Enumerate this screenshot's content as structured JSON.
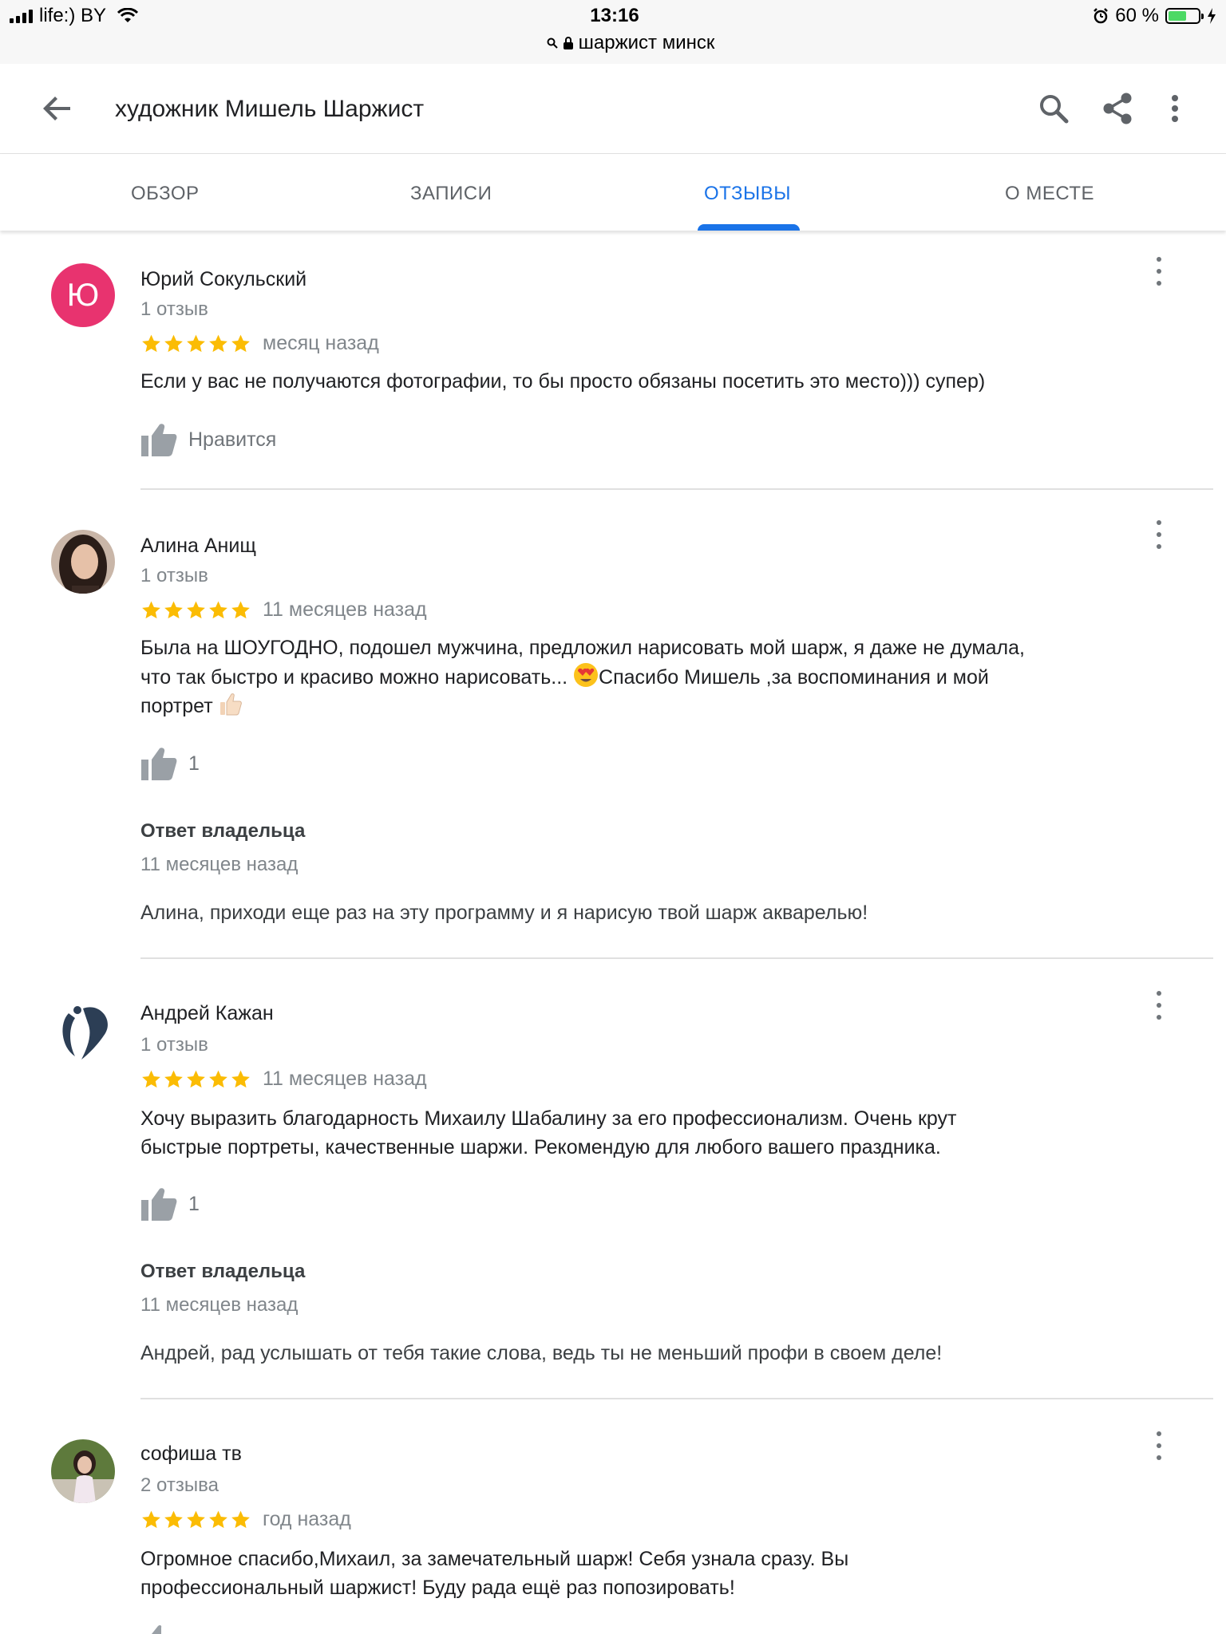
{
  "status_bar": {
    "carrier": "life:) BY",
    "time": "13:16",
    "url": "шаржист минск",
    "battery": "60 %",
    "battery_level": 0.6
  },
  "app_bar": {
    "title": "художник Мишель Шаржист",
    "icons": [
      "back-arrow-icon",
      "search-icon",
      "share-icon",
      "more-vert-icon"
    ]
  },
  "tabs": [
    {
      "label": "ОБЗОР",
      "active": false
    },
    {
      "label": "ЗАПИСИ",
      "active": false
    },
    {
      "label": "ОТЗЫВЫ",
      "active": true
    },
    {
      "label": "О МЕСТЕ",
      "active": false
    }
  ],
  "colors": {
    "accent": "#1a73e8",
    "star": "#fbbc04",
    "avatar_letter_bg": "#e8336f"
  },
  "reviews": [
    {
      "name": "Юрий Сокульский",
      "avatar_letter": "Ю",
      "count": "1 отзыв",
      "rating": 5,
      "date": "месяц назад",
      "text": "Если у вас не получаются фотографии, то бы просто обязаны посетить это место))) супер)",
      "like_label": "Нравится"
    },
    {
      "name": "Алина Анищ",
      "count": "1 отзыв",
      "rating": 5,
      "date": "11 месяцев назад",
      "text_lines": [
        "Была на ШОУГОДНО, подошел мужчина, предложил нарисовать мой шарж, я даже не думала,",
        "что так быстро и красиво можно нарисовать... ",
        "Спасибо Мишель ,за воспоминания и мой",
        "портрет "
      ],
      "likes": "1",
      "owner_reply": {
        "title": "Ответ владельца",
        "date": "11 месяцев назад",
        "text": "Алина, приходи еще раз на эту программу и я нарисую твой шарж акварелью!"
      }
    },
    {
      "name": "Андрей Кажан",
      "count": "1 отзыв",
      "rating": 5,
      "date": "11 месяцев назад",
      "text_lines": [
        "Хочу выразить благодарность  Михаилу Шабалину за его профессионализм. Очень крут",
        "быстрые портреты, качественные шаржи. Рекомендую для любого вашего праздника."
      ],
      "likes": "1",
      "owner_reply": {
        "title": "Ответ владельца",
        "date": "11 месяцев назад",
        "text": "Андрей, рад услышать от тебя такие слова, ведь ты не меньший профи в своем деле!"
      }
    },
    {
      "name": "софиша тв",
      "count": "2 отзыва",
      "rating": 5,
      "date": "год назад",
      "text_lines": [
        "Огромное спасибо,Михаил, за замечательный шарж! Себя узнала сразу. Вы",
        "профессиональный шаржист! Буду рада ещё раз попозировать!"
      ]
    }
  ]
}
